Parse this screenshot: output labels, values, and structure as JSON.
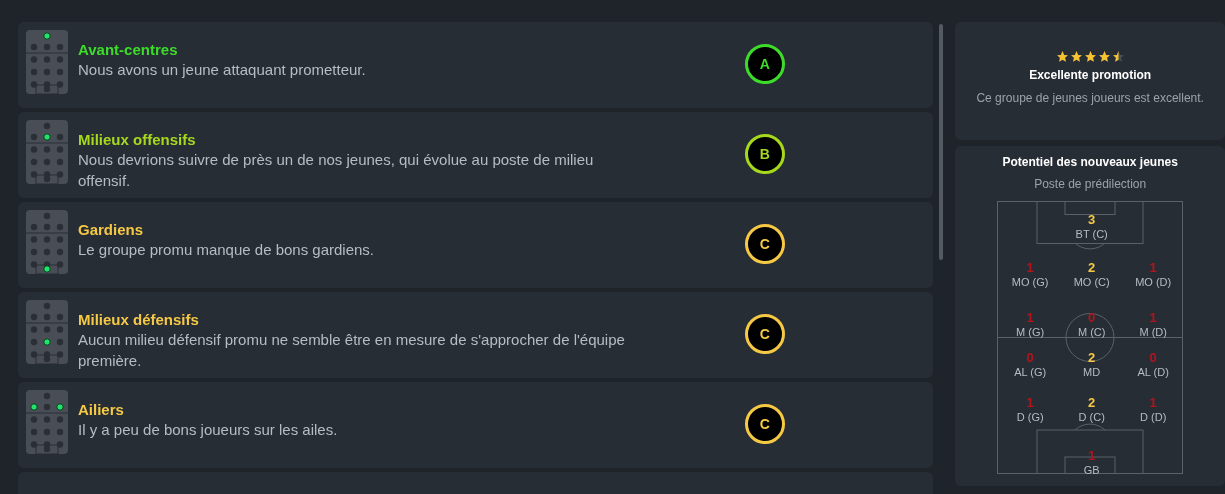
{
  "groups": [
    {
      "title": "Avant-centres",
      "text": "Nous avons un jeune attaquant prometteur.",
      "grade": "A",
      "color": "#3ddc2a",
      "kind": "strikers"
    },
    {
      "title": "Milieux offensifs",
      "text": "Nous devrions suivre de près un de nos jeunes, qui évolue au poste de milieu offensif.",
      "grade": "B",
      "color": "#a6d81c",
      "kind": "attacking-midfield"
    },
    {
      "title": "Gardiens",
      "text": "Le groupe promu manque de bons gardiens.",
      "grade": "C",
      "color": "#f6c945",
      "kind": "goalkeepers"
    },
    {
      "title": "Milieux défensifs",
      "text": "Aucun milieu défensif promu ne semble être en mesure de s'approcher de l'équipe première.",
      "grade": "C",
      "color": "#f6c945",
      "kind": "defensive-midfield"
    },
    {
      "title": "Ailiers",
      "text": "Il y a peu de bons joueurs sur les ailes.",
      "grade": "C",
      "color": "#f6c945",
      "kind": "wingers"
    }
  ],
  "summary": {
    "stars": 4.5,
    "title": "Excellente promotion",
    "text": "Ce groupe de jeunes joueurs est excellent."
  },
  "potential": {
    "title": "Potentiel des nouveaux jeunes",
    "subtitle": "Poste de prédilection",
    "rows": [
      [
        {
          "count": "3",
          "label": "BT (C)",
          "color": "#f6c945"
        }
      ],
      [
        {
          "count": "1",
          "label": "MO (G)",
          "color": "#b3141c"
        },
        {
          "count": "2",
          "label": "MO (C)",
          "color": "#f6c945"
        },
        {
          "count": "1",
          "label": "MO (D)",
          "color": "#b3141c"
        }
      ],
      [
        {
          "count": "1",
          "label": "M (G)",
          "color": "#b3141c"
        },
        {
          "count": "0",
          "label": "M (C)",
          "color": "#b3141c"
        },
        {
          "count": "1",
          "label": "M (D)",
          "color": "#b3141c"
        }
      ],
      [
        {
          "count": "0",
          "label": "AL (G)",
          "color": "#b3141c"
        },
        {
          "count": "2",
          "label": "MD",
          "color": "#f6c945"
        },
        {
          "count": "0",
          "label": "AL (D)",
          "color": "#b3141c"
        }
      ],
      [
        {
          "count": "1",
          "label": "D (G)",
          "color": "#b3141c"
        },
        {
          "count": "2",
          "label": "D (C)",
          "color": "#f6c945"
        },
        {
          "count": "1",
          "label": "D (D)",
          "color": "#b3141c"
        }
      ],
      [
        {
          "count": "1",
          "label": "GB",
          "color": "#b3141c"
        }
      ]
    ]
  }
}
